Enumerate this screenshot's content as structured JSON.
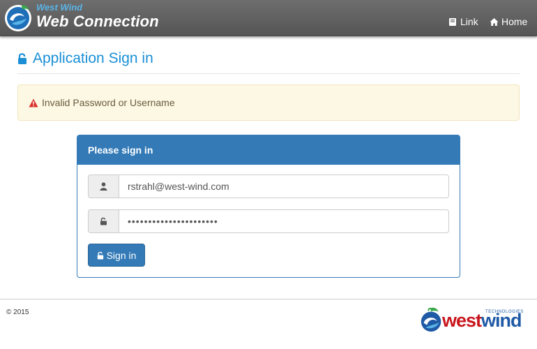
{
  "navbar": {
    "brand_top": "West Wind",
    "brand_main": "Web Connection",
    "links": [
      {
        "label": "Link",
        "icon": "book-icon"
      },
      {
        "label": "Home",
        "icon": "home-icon"
      }
    ]
  },
  "page": {
    "title": "Application Sign in",
    "title_icon": "unlock-icon"
  },
  "alert": {
    "message": "Invalid Password or Username",
    "icon": "warning-icon"
  },
  "panel": {
    "heading": "Please sign in",
    "username": {
      "value": "rstrahl@west-wind.com",
      "icon": "user-icon"
    },
    "password": {
      "value": "••••••••••••••••••••••",
      "icon": "unlock-icon"
    },
    "submit_label": "Sign in"
  },
  "footer": {
    "copyright": "© 2015",
    "logo_west": "west",
    "logo_wind": "wind",
    "logo_tech": "TECHNOLOGIES"
  },
  "colors": {
    "navbar": "#5f5f5f",
    "title": "#1a8fd6",
    "alert_bg": "#fcf8e3",
    "panel_primary": "#337ab7",
    "warning_icon": "#d9302a"
  }
}
